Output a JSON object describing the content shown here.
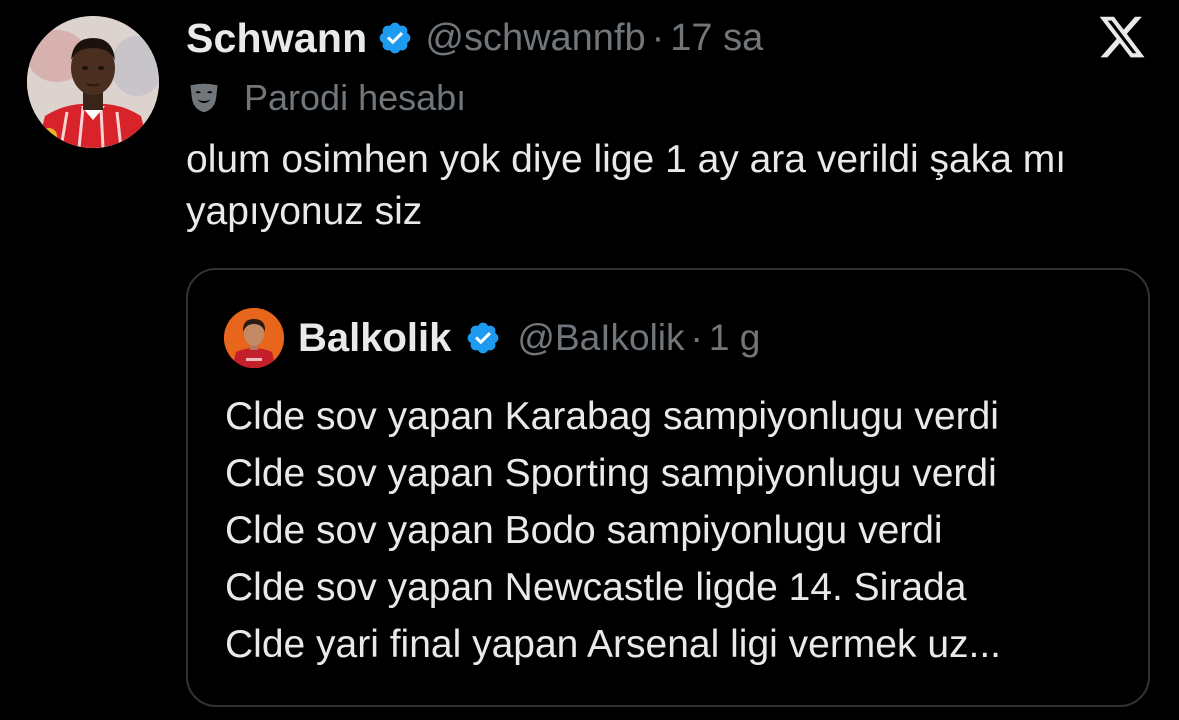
{
  "tweet": {
    "author": {
      "display_name": "Schwann",
      "handle": "@schwannfb",
      "avatar_icon": "profile-photo-icon"
    },
    "separator": "·",
    "time": "17 sa",
    "parody_label": "Parodi hesabı",
    "parody_icon": "theater-mask-icon",
    "text": "olum osimhen yok diye lige 1 ay ara verildi şaka mı yapıyonuz siz",
    "platform_icon": "x-logo-icon"
  },
  "quoted_tweet": {
    "author": {
      "display_name": "Balkolik",
      "handle": "@BaIkolik",
      "avatar_icon": "profile-photo-icon"
    },
    "separator": "·",
    "time": "1 g",
    "lines": [
      "Clde sov yapan Karabag sampiyonlugu verdi",
      "Clde sov yapan Sporting sampiyonlugu verdi",
      "Clde sov yapan Bodo sampiyonlugu verdi",
      "Clde sov yapan Newcastle ligde 14. Sirada",
      "Clde yari final yapan Arsenal ligi vermek uz..."
    ]
  },
  "colors": {
    "background": "#000000",
    "primary_text": "#e7e9ea",
    "secondary_text": "#71767b",
    "border": "#2f3336",
    "verified_blue": "#1d9bf0"
  }
}
